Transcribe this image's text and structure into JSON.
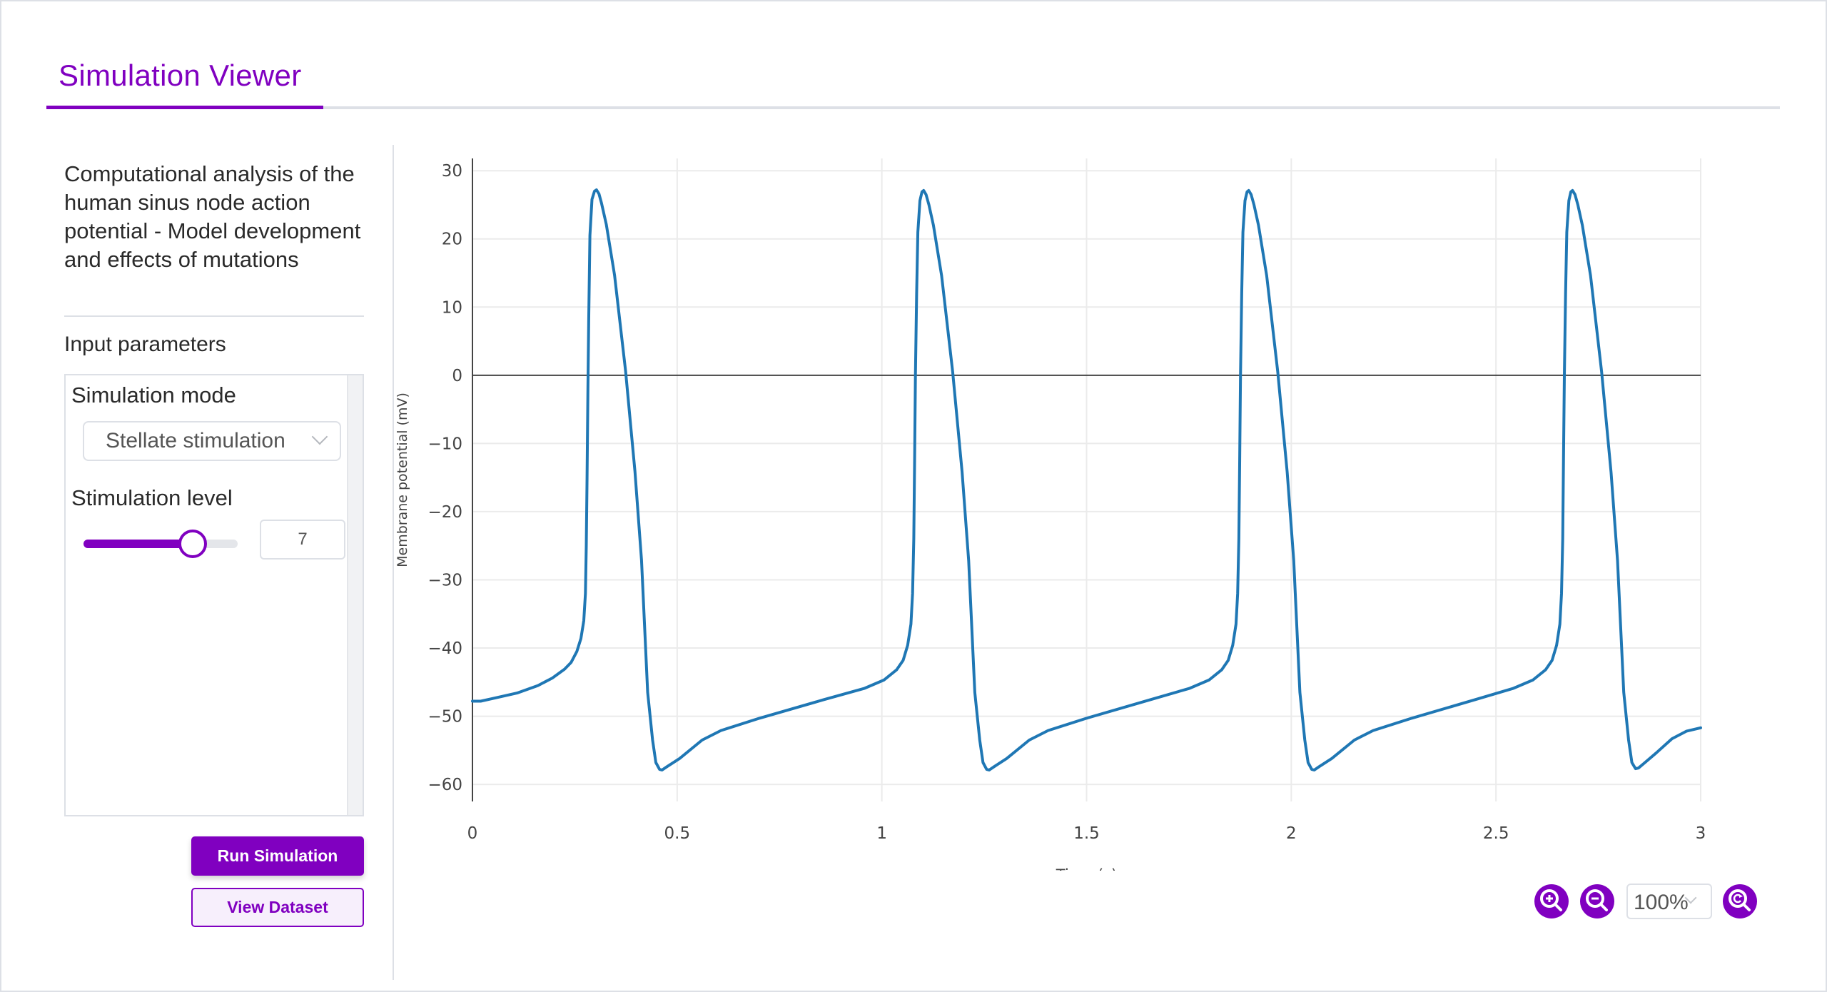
{
  "app": {
    "title": "Simulation Viewer",
    "accent_color": "#8000c0"
  },
  "sidebar": {
    "study_title": "Computational analysis of the human sinus node action potential - Model development and effects of mutations",
    "section_label": "Input parameters",
    "fields": {
      "mode_label": "Simulation mode",
      "mode_value": "Stellate stimulation",
      "level_label": "Stimulation level",
      "level_value": "7",
      "level_min": 0,
      "level_max": 10
    },
    "buttons": {
      "run": "Run Simulation",
      "view": "View Dataset"
    }
  },
  "zoom_controls": {
    "zoom_in_icon": "zoom-in-icon",
    "zoom_out_icon": "zoom-out-icon",
    "zoom_level": "100%",
    "reset_icon": "zoom-reset-icon"
  },
  "chart_data": {
    "type": "line",
    "title": "",
    "xlabel": "Time (s)",
    "ylabel": "Membrane potential (mV)",
    "xlim": [
      0,
      3
    ],
    "ylim": [
      -62.5,
      31.8
    ],
    "xticks": [
      0,
      0.5,
      1,
      1.5,
      2,
      2.5,
      3
    ],
    "xtick_labels": [
      "0",
      "0.5",
      "1",
      "1.5",
      "2",
      "2.5",
      "3"
    ],
    "yticks": [
      30,
      20,
      10,
      0,
      -10,
      -20,
      -30,
      -40,
      -50,
      -60
    ],
    "ytick_labels": [
      "30",
      "20",
      "10",
      "0",
      "−10",
      "−20",
      "−30",
      "−40",
      "−50",
      "−60"
    ],
    "grid": true,
    "zero_line": true,
    "line_color": "#1f77b4",
    "series": [
      {
        "name": "Membrane potential",
        "points": [
          [
            0.0,
            -47.8
          ],
          [
            0.02,
            -47.8
          ],
          [
            0.05,
            -47.4
          ],
          [
            0.109,
            -46.6
          ],
          [
            0.16,
            -45.5
          ],
          [
            0.195,
            -44.4
          ],
          [
            0.225,
            -43.1
          ],
          [
            0.241,
            -42.1
          ],
          [
            0.255,
            -40.5
          ],
          [
            0.265,
            -38.6
          ],
          [
            0.272,
            -36.0
          ],
          [
            0.276,
            -32.0
          ],
          [
            0.278,
            -25.0
          ],
          [
            0.28,
            -15.0
          ],
          [
            0.282,
            -2.0
          ],
          [
            0.284,
            8.0
          ],
          [
            0.287,
            20.5
          ],
          [
            0.292,
            25.8
          ],
          [
            0.298,
            27.0
          ],
          [
            0.303,
            27.2
          ],
          [
            0.309,
            26.6
          ],
          [
            0.315,
            25.3
          ],
          [
            0.327,
            22.1
          ],
          [
            0.347,
            14.7
          ],
          [
            0.374,
            0.6
          ],
          [
            0.397,
            -14.1
          ],
          [
            0.413,
            -27.1
          ],
          [
            0.428,
            -46.5
          ],
          [
            0.44,
            -53.5
          ],
          [
            0.448,
            -56.8
          ],
          [
            0.457,
            -57.8
          ],
          [
            0.463,
            -57.9
          ],
          [
            0.475,
            -57.4
          ],
          [
            0.506,
            -56.2
          ],
          [
            0.561,
            -53.5
          ],
          [
            0.607,
            -52.1
          ],
          [
            0.701,
            -50.3
          ],
          [
            0.857,
            -47.6
          ],
          [
            0.958,
            -45.9
          ],
          [
            1.005,
            -44.7
          ],
          [
            1.036,
            -43.2
          ],
          [
            1.052,
            -41.8
          ],
          [
            1.063,
            -39.6
          ],
          [
            1.071,
            -36.5
          ],
          [
            1.075,
            -32.0
          ],
          [
            1.078,
            -24.0
          ],
          [
            1.08,
            -12.0
          ],
          [
            1.082,
            0.0
          ],
          [
            1.085,
            12.0
          ],
          [
            1.088,
            21.0
          ],
          [
            1.093,
            25.6
          ],
          [
            1.098,
            26.9
          ],
          [
            1.102,
            27.1
          ],
          [
            1.108,
            26.5
          ],
          [
            1.115,
            25.0
          ],
          [
            1.126,
            22.0
          ],
          [
            1.146,
            14.6
          ],
          [
            1.173,
            0.5
          ],
          [
            1.196,
            -14.2
          ],
          [
            1.212,
            -27.2
          ],
          [
            1.227,
            -46.5
          ],
          [
            1.239,
            -53.5
          ],
          [
            1.247,
            -56.8
          ],
          [
            1.256,
            -57.8
          ],
          [
            1.262,
            -57.9
          ],
          [
            1.274,
            -57.4
          ],
          [
            1.305,
            -56.2
          ],
          [
            1.36,
            -53.5
          ],
          [
            1.406,
            -52.1
          ],
          [
            1.5,
            -50.3
          ],
          [
            1.655,
            -47.6
          ],
          [
            1.752,
            -45.9
          ],
          [
            1.799,
            -44.7
          ],
          [
            1.83,
            -43.2
          ],
          [
            1.846,
            -41.8
          ],
          [
            1.857,
            -39.6
          ],
          [
            1.865,
            -36.5
          ],
          [
            1.869,
            -32.0
          ],
          [
            1.872,
            -24.0
          ],
          [
            1.874,
            -12.0
          ],
          [
            1.876,
            0.0
          ],
          [
            1.879,
            12.0
          ],
          [
            1.882,
            21.0
          ],
          [
            1.887,
            25.6
          ],
          [
            1.892,
            26.9
          ],
          [
            1.896,
            27.1
          ],
          [
            1.902,
            26.5
          ],
          [
            1.909,
            25.0
          ],
          [
            1.92,
            22.0
          ],
          [
            1.94,
            14.6
          ],
          [
            1.967,
            0.5
          ],
          [
            1.99,
            -14.2
          ],
          [
            2.006,
            -27.2
          ],
          [
            2.021,
            -46.5
          ],
          [
            2.033,
            -53.5
          ],
          [
            2.041,
            -56.8
          ],
          [
            2.05,
            -57.8
          ],
          [
            2.056,
            -57.9
          ],
          [
            2.068,
            -57.4
          ],
          [
            2.099,
            -56.2
          ],
          [
            2.154,
            -53.5
          ],
          [
            2.2,
            -52.1
          ],
          [
            2.294,
            -50.3
          ],
          [
            2.448,
            -47.6
          ],
          [
            2.543,
            -45.9
          ],
          [
            2.59,
            -44.7
          ],
          [
            2.621,
            -43.2
          ],
          [
            2.637,
            -41.8
          ],
          [
            2.648,
            -39.6
          ],
          [
            2.656,
            -36.5
          ],
          [
            2.66,
            -32.0
          ],
          [
            2.663,
            -24.0
          ],
          [
            2.665,
            -12.0
          ],
          [
            2.667,
            0.0
          ],
          [
            2.67,
            12.0
          ],
          [
            2.673,
            21.0
          ],
          [
            2.678,
            25.6
          ],
          [
            2.683,
            26.9
          ],
          [
            2.687,
            27.1
          ],
          [
            2.693,
            26.5
          ],
          [
            2.7,
            25.0
          ],
          [
            2.711,
            22.0
          ],
          [
            2.731,
            14.6
          ],
          [
            2.758,
            0.5
          ],
          [
            2.781,
            -14.2
          ],
          [
            2.797,
            -27.2
          ],
          [
            2.812,
            -46.5
          ],
          [
            2.824,
            -53.5
          ],
          [
            2.832,
            -56.8
          ],
          [
            2.841,
            -57.7
          ],
          [
            2.848,
            -57.6
          ],
          [
            2.86,
            -57.0
          ],
          [
            2.891,
            -55.4
          ],
          [
            2.93,
            -53.3
          ],
          [
            2.965,
            -52.2
          ],
          [
            3.0,
            -51.7
          ]
        ]
      }
    ]
  }
}
